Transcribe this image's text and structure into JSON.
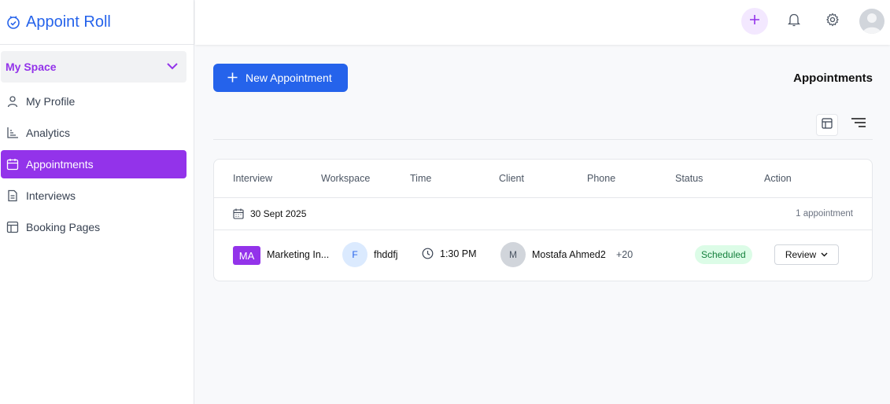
{
  "app": {
    "title": "Appoint Roll"
  },
  "sidebar": {
    "space_label": "My Space",
    "items": [
      {
        "label": "My Profile",
        "icon": "user-icon"
      },
      {
        "label": "Analytics",
        "icon": "chart-icon"
      },
      {
        "label": "Appointments",
        "icon": "calendar-icon",
        "active": true
      },
      {
        "label": "Interviews",
        "icon": "document-icon"
      },
      {
        "label": "Booking Pages",
        "icon": "layout-icon"
      }
    ]
  },
  "colors": {
    "primary": "#2563eb",
    "accent": "#9333ea",
    "status_scheduled": "#dcfce7"
  },
  "main": {
    "new_button_label": "New Appointment",
    "page_title": "Appointments",
    "table": {
      "headers": [
        "Interview",
        "Workspace",
        "Time",
        "Client",
        "Phone",
        "Status",
        "Action"
      ],
      "group": {
        "date": "30 Sept 2025",
        "count": "1 appointment"
      },
      "rows": [
        {
          "interview_badge": "MA",
          "interview_name": "Marketing In...",
          "workspace_initial": "F",
          "workspace_name": "fhddfj",
          "time": "1:30 PM",
          "client_initial": "M",
          "client_name": "Mostafa Ahmed2",
          "phone": "+20",
          "status": "Scheduled",
          "action": "Review"
        }
      ]
    }
  }
}
